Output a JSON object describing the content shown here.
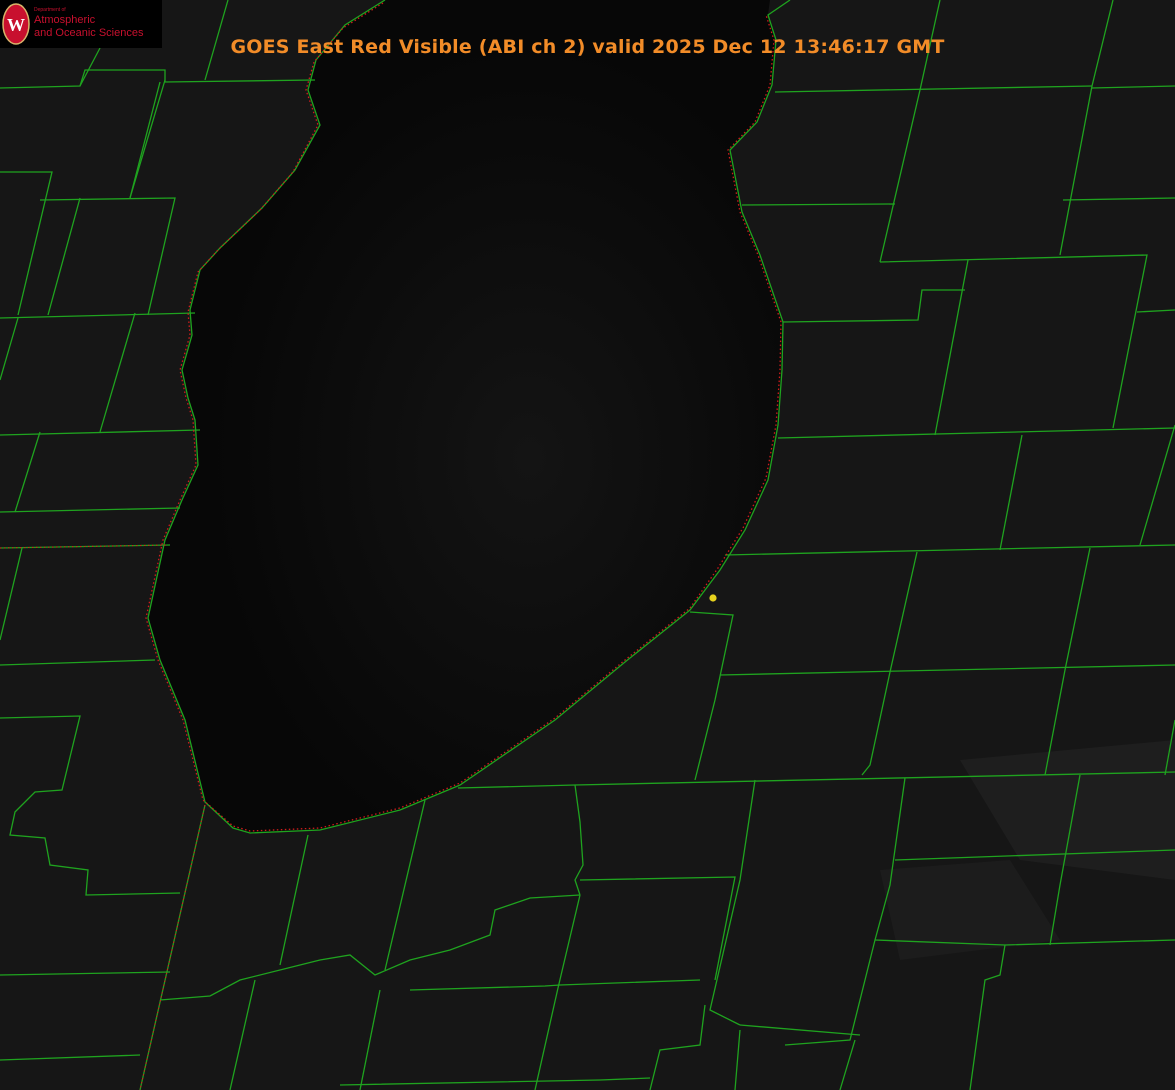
{
  "title": "GOES East Red Visible (ABI ch 2) valid 2025 Dec 12 13:46:17 GMT",
  "logo": {
    "line0": "Department of",
    "line1": "Atmospheric",
    "line2": "and Oceanic Sciences",
    "seal_letter": "W"
  },
  "colors": {
    "background": "#000000",
    "land": "#161616",
    "lake": "#070707",
    "county_lines": "#1fa31f",
    "shoreline_dotted": "#d11c1c",
    "title": "#f28c28",
    "station_dot": "#e6d21e"
  },
  "map_features": [
    "lake",
    "shoreline",
    "county-boundaries",
    "state-boundary",
    "station-marker"
  ]
}
